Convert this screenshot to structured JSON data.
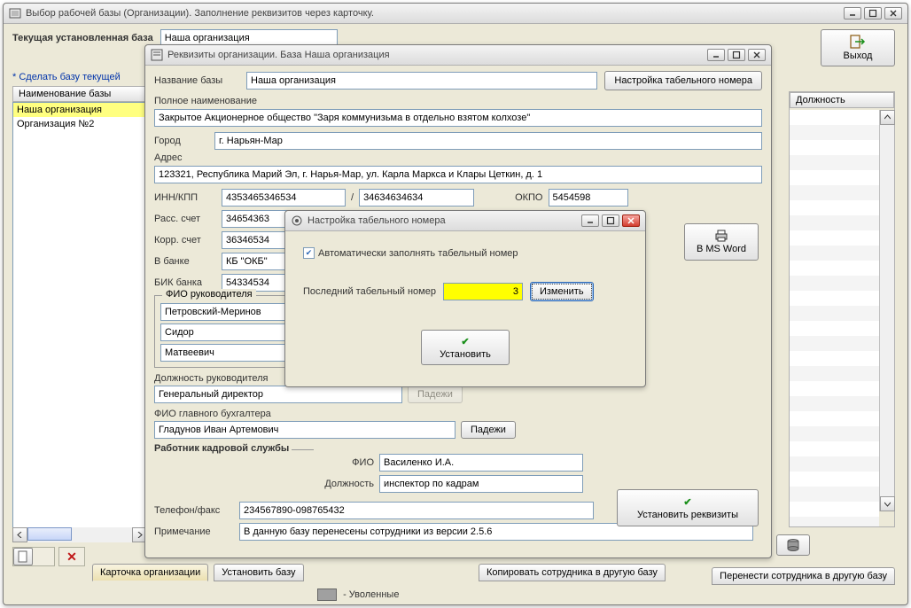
{
  "main": {
    "title": "Выбор рабочей базы (Организации). Заполнение реквизитов через карточку.",
    "current_base_label": "Текущая установленная база",
    "current_base_value": "Наша организация",
    "make_current_label": "* Сделать базу текущей",
    "list_header": "Наименование базы",
    "list_items": [
      "Наша организация",
      "Организация №2"
    ],
    "position_header": "Должность",
    "exit_label": "Выход",
    "bottom_tabs": {
      "card": "Карточка организации",
      "set_base": "Установить базу",
      "copy_emp": "Копировать сотрудника в другую базу",
      "move_emp": "Перенести сотрудника в другую базу"
    },
    "dismissed_label": "- Уволенные"
  },
  "org": {
    "title": "Реквизиты организации. База Наша организация",
    "base_name_label": "Название базы",
    "base_name_value": "Наша организация",
    "tabnum_btn": "Настройка табельного номера",
    "full_name_label": "Полное наименование",
    "full_name_value": "Закрытое Акционерное общество \"Заря коммунизьма в отдельно взятом колхозе\"",
    "city_label": "Город",
    "city_value": "г. Нарьян-Мар",
    "address_label": "Адрес",
    "address_value": "123321, Республика Марий Эл, г. Нарья-Мар, ул. Карла Маркса и Клары Цеткин, д. 1",
    "inn_kpp_label": "ИНН/КПП",
    "inn_value": "4353465346534",
    "kpp_value": "34634634634",
    "okpo_label": "ОКПО",
    "okpo_value": "5454598",
    "rs_label": "Расс. счет",
    "rs_value": "34654363",
    "ks_label": "Корр. счет",
    "ks_value": "36346534",
    "bank_label": "В банке",
    "bank_value": "КБ \"ОКБ\"",
    "bik_label": "БИК банка",
    "bik_value": "54334534",
    "msword_label": "В MS Word",
    "fio_head_legend": "ФИО руководителя",
    "head_surname": "Петровский-Меринов",
    "head_name": "Сидор",
    "head_patronymic": "Матвеевич",
    "head_position_label": "Должность руководителя",
    "head_position_value": "Генеральный директор",
    "padezhi_label": "Падежи",
    "chief_acc_label": "ФИО главного бухгалтера",
    "chief_acc_value": "Гладунов Иван Артемович",
    "hr_legend": "Работник кадровой службы",
    "hr_fio_label": "ФИО",
    "hr_fio_value": "Василенко И.А.",
    "hr_pos_label": "Должность",
    "hr_pos_value": "инспектор по кадрам",
    "set_details_btn": "Установить реквизиты",
    "phone_label": "Телефон/факс",
    "phone_value": "234567890-098765432",
    "note_label": "Примечание",
    "note_value": "В данную базу перенесены сотрудники из версии 2.5.6"
  },
  "tabnum": {
    "title": "Настройка табельного номера",
    "auto_label": "Автоматически заполнять табельный номер",
    "last_label": "Последний табельный номер",
    "last_value": "3",
    "change_btn": "Изменить",
    "install_btn": "Установить"
  }
}
